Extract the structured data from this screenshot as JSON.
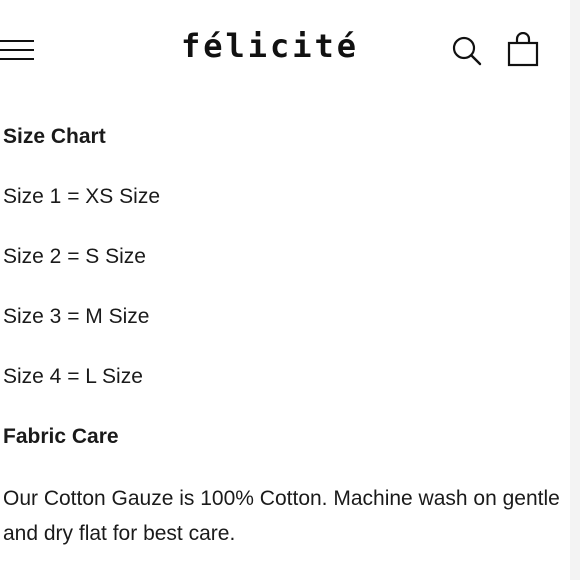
{
  "header": {
    "brand": "félicité",
    "icons": {
      "menu": "hamburger-menu-icon",
      "search": "search-icon",
      "bag": "shopping-bag-icon"
    }
  },
  "size_chart": {
    "heading": "Size Chart",
    "rows": [
      "Size 1 = XS Size",
      "Size 2 = S Size",
      "Size 3 = M Size",
      "Size 4 = L Size"
    ]
  },
  "fabric_care": {
    "heading": "Fabric Care",
    "text": "Our Cotton Gauze is 100% Cotton. Machine wash on gentle and dry flat for best care."
  }
}
